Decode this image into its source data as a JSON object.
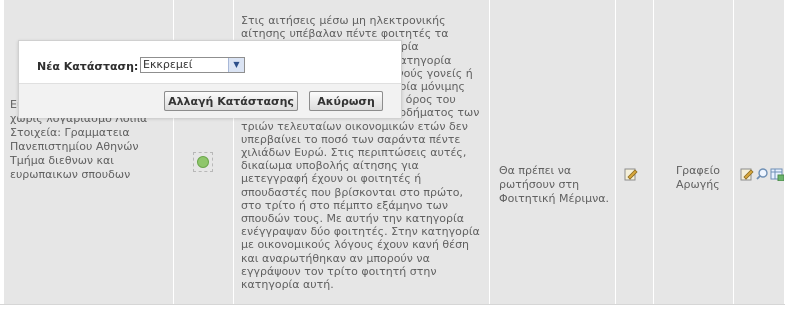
{
  "row": {
    "user_info": "Είδος χρήστη: Χρήστης χωρίς λογαριασμό Λοιπά Στοιχεία: Γραμματεια Πανεπιστημίου Αθηνών Τμήμα διεθνων και ευρωπαικων σπουδων",
    "description": "Στις αιτήσεις μέσω μη ηλεκτρονικής αίτησης υπέβαλαν πέντε φοιτητές τα δικαιολογητικά στην κατηγορία οικονομικών λόγων ή στην κατηγορία φοιτητών με ορφανό ή ορφανούς γονείς ή πανεπιστημίου. Στην κατηγορία μόνιμης κατοικίας προκύπτει ο μέσος όρος του συνολικού οικογενειακού εισοδήματος των τριών τελευταίων οικονομικών ετών δεν υπερβαίνει το ποσό των σαράντα πέντε χιλιάδων Ευρώ. Στις περιπτώσεις αυτές, δικαίωμα υποβολής αίτησης για μετεγγραφή έχουν οι φοιτητές ή σπουδαστές που βρίσκονται στο πρώτο, στο τρίτο ή στο πέμπτο εξάμηνο των σπουδών τους. Με αυτήν την κατηγορία ενέγγραψαν δύο φοιτητές. Στην κατηγορία με οικονομικούς λόγους έχουν κανή θέση και αναρωτήθηκαν αν μπορούν να εγγράψουν τον τρίτο φοιτητή στην κατηγορία αυτή.",
    "response": "Θα πρέπει να ρωτήσουν στη Φοιτητική Μέριμνα.",
    "office": "Γραφείο Αρωγής"
  },
  "icons": {
    "status": "status-ok-icon",
    "edit": "edit-icon",
    "search": "search-icon",
    "table": "table-icon"
  },
  "dialog": {
    "status_label": "Νέα Κατάσταση:",
    "select_value": "Εκκρεμεί",
    "change_button": "Αλλαγή Κατάστασης",
    "cancel_button": "Ακύρωση"
  }
}
